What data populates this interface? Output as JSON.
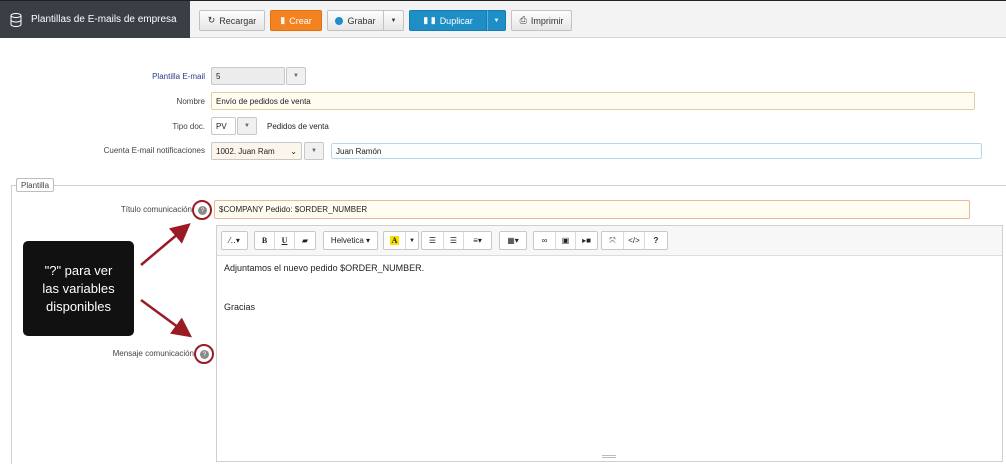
{
  "header": {
    "title": "Plantillas de E-mails de empresa",
    "buttons": {
      "recargar": "Recargar",
      "crear": "Crear",
      "grabar": "Grabar",
      "duplicar": "Duplicar",
      "imprimir": "Imprimir"
    }
  },
  "form": {
    "plantilla": {
      "label": "Plantilla E-mail",
      "value": "5"
    },
    "nombre": {
      "label": "Nombre",
      "value": "Envío de pedidos de venta"
    },
    "tipo_doc": {
      "label": "Tipo doc.",
      "value": "PV",
      "description": "Pedidos de venta"
    },
    "cuenta": {
      "label": "Cuenta E-mail notificaciones",
      "value": "1002. Juan Ram",
      "name": "Juan Ramón"
    }
  },
  "fieldset": {
    "legend": "Plantilla",
    "titulo": {
      "label": "Título comunicación",
      "value": "$COMPANY  Pedido: $ORDER_NUMBER"
    },
    "mensaje": {
      "label": "Mensaje comunicación"
    }
  },
  "editor": {
    "font": "Helvetica",
    "lines": [
      "Adjuntamos el nuevo pedido $ORDER_NUMBER.",
      "Gracias"
    ]
  },
  "callout": {
    "line1": "\"?\" para ver",
    "line2": "las variables",
    "line3": "disponibles"
  },
  "colors": {
    "accent_orange": "#f58220",
    "accent_blue": "#1e8fc6",
    "annotation_red": "#9b1b24"
  }
}
